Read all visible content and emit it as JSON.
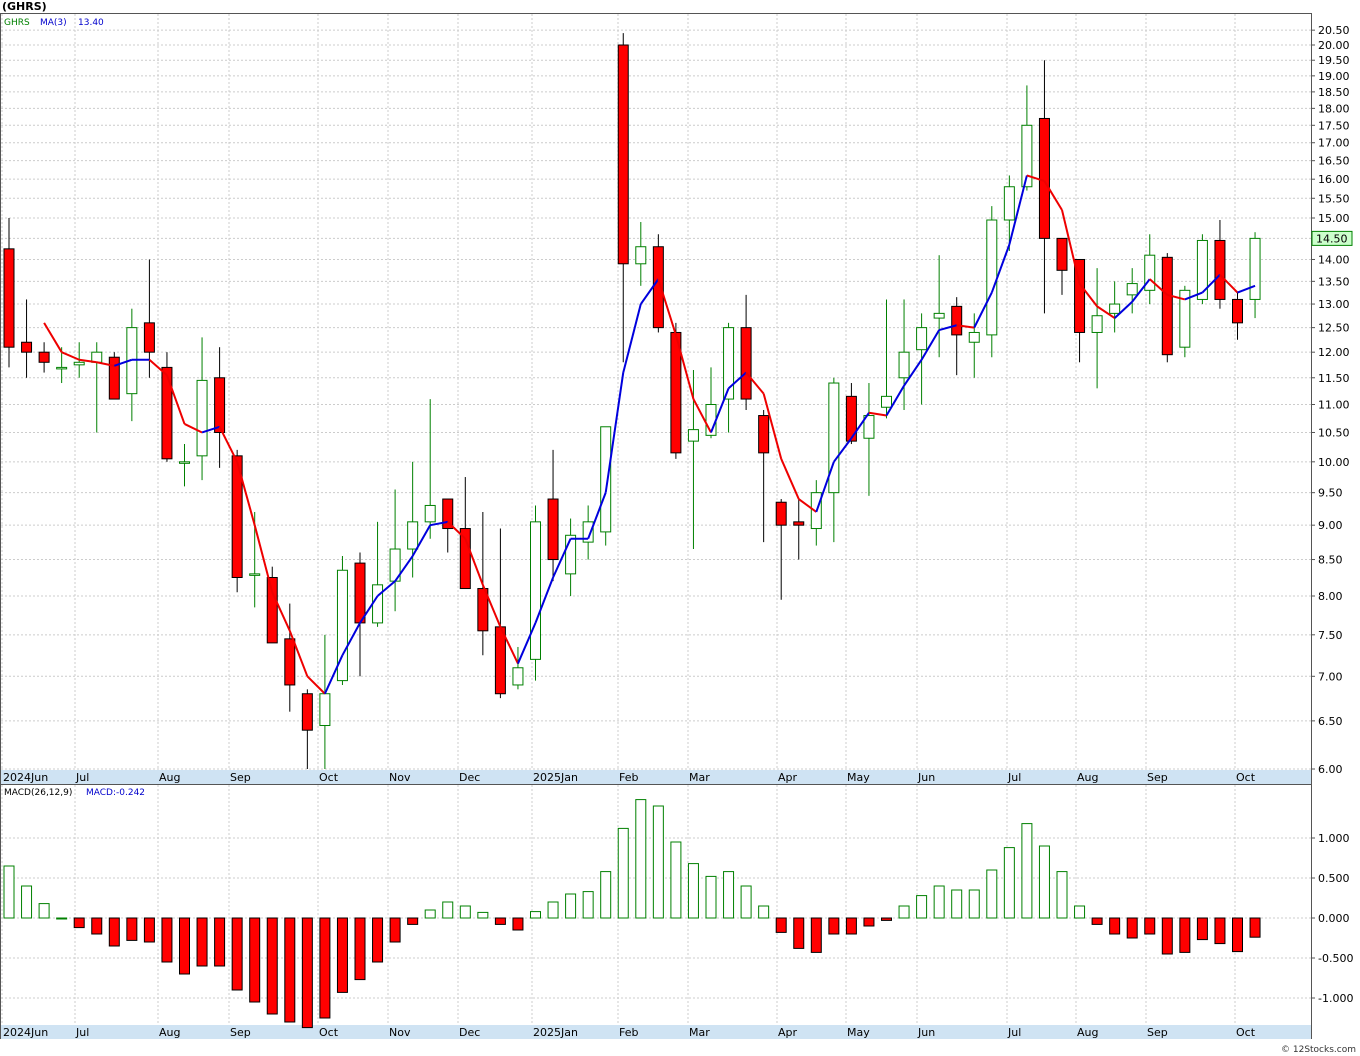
{
  "title": "(GHRS)",
  "footer": "© 12Stocks.com",
  "colors": {
    "up": "#008000",
    "down": "#ff0000",
    "ma_up": "#0000dd",
    "ma_down": "#ee0000",
    "axis_bg": "#cfe3f3",
    "price_tag_bg": "#ccffcc"
  },
  "x_axis_labels": [
    "2024Jun",
    "Jul",
    "Aug",
    "Sep",
    "Oct",
    "Nov",
    "Dec",
    "2025Jan",
    "Feb",
    "Mar",
    "Apr",
    "May",
    "Jun",
    "Jul",
    "Aug",
    "Sep",
    "Oct"
  ],
  "chart_data": [
    {
      "type": "candlestick",
      "title": "(GHRS)",
      "legend": {
        "symbol": "GHRS",
        "indicator": "MA(3)",
        "indicator_value": "13.40"
      },
      "last_price": "14.50",
      "ylim": [
        6.0,
        20.6
      ],
      "y_ticks": [
        "20.50",
        "20.00",
        "19.50",
        "19.00",
        "18.50",
        "18.00",
        "17.50",
        "17.00",
        "16.50",
        "16.00",
        "15.50",
        "15.00",
        "14.50",
        "14.00",
        "13.50",
        "13.00",
        "12.50",
        "12.00",
        "11.50",
        "11.00",
        "10.50",
        "10.00",
        "9.50",
        "9.00",
        "8.50",
        "8.00",
        "7.50",
        "7.00",
        "6.50",
        "6.00"
      ],
      "log_scale": true,
      "grid": true,
      "candles": [
        {
          "o": 14.25,
          "h": 15.0,
          "l": 11.7,
          "c": 12.1
        },
        {
          "o": 12.2,
          "h": 13.1,
          "l": 11.5,
          "c": 12.0
        },
        {
          "o": 12.0,
          "h": 12.2,
          "l": 11.6,
          "c": 11.8
        },
        {
          "o": 11.7,
          "h": 12.1,
          "l": 11.4,
          "c": 11.7
        },
        {
          "o": 11.75,
          "h": 12.2,
          "l": 11.5,
          "c": 11.8
        },
        {
          "o": 11.8,
          "h": 12.2,
          "l": 10.5,
          "c": 12.0
        },
        {
          "o": 11.9,
          "h": 12.0,
          "l": 11.2,
          "c": 11.1
        },
        {
          "o": 11.2,
          "h": 12.9,
          "l": 10.7,
          "c": 12.5
        },
        {
          "o": 12.6,
          "h": 14.0,
          "l": 11.5,
          "c": 12.0
        },
        {
          "o": 11.7,
          "h": 12.0,
          "l": 10.0,
          "c": 10.05
        },
        {
          "o": 10.0,
          "h": 10.3,
          "l": 9.6,
          "c": 10.0
        },
        {
          "o": 10.1,
          "h": 12.3,
          "l": 9.7,
          "c": 11.45
        },
        {
          "o": 11.5,
          "h": 12.1,
          "l": 9.9,
          "c": 10.5
        },
        {
          "o": 10.1,
          "h": 10.2,
          "l": 8.05,
          "c": 8.25
        },
        {
          "o": 8.3,
          "h": 9.2,
          "l": 7.85,
          "c": 8.3
        },
        {
          "o": 8.25,
          "h": 8.4,
          "l": 7.4,
          "c": 7.4
        },
        {
          "o": 7.45,
          "h": 7.9,
          "l": 6.6,
          "c": 6.9
        },
        {
          "o": 6.8,
          "h": 6.85,
          "l": 6.0,
          "c": 6.4
        },
        {
          "o": 6.45,
          "h": 7.5,
          "l": 6.0,
          "c": 6.8
        },
        {
          "o": 6.95,
          "h": 8.55,
          "l": 6.9,
          "c": 8.35
        },
        {
          "o": 8.45,
          "h": 8.6,
          "l": 7.0,
          "c": 7.65
        },
        {
          "o": 7.65,
          "h": 9.05,
          "l": 7.6,
          "c": 8.15
        },
        {
          "o": 8.2,
          "h": 9.55,
          "l": 7.8,
          "c": 8.65
        },
        {
          "o": 8.65,
          "h": 10.0,
          "l": 8.25,
          "c": 9.05
        },
        {
          "o": 9.05,
          "h": 11.1,
          "l": 8.8,
          "c": 9.3
        },
        {
          "o": 9.4,
          "h": 9.4,
          "l": 8.6,
          "c": 8.95
        },
        {
          "o": 8.95,
          "h": 9.75,
          "l": 8.1,
          "c": 8.1
        },
        {
          "o": 8.1,
          "h": 9.2,
          "l": 7.25,
          "c": 7.55
        },
        {
          "o": 7.6,
          "h": 8.95,
          "l": 6.75,
          "c": 6.8
        },
        {
          "o": 6.9,
          "h": 7.35,
          "l": 6.85,
          "c": 7.1
        },
        {
          "o": 7.2,
          "h": 9.3,
          "l": 6.95,
          "c": 9.05
        },
        {
          "o": 9.4,
          "h": 10.2,
          "l": 8.2,
          "c": 8.5
        },
        {
          "o": 8.3,
          "h": 9.1,
          "l": 8.0,
          "c": 8.85
        },
        {
          "o": 8.75,
          "h": 9.3,
          "l": 8.5,
          "c": 9.05
        },
        {
          "o": 8.9,
          "h": 10.6,
          "l": 8.7,
          "c": 10.6
        },
        {
          "o": 20.0,
          "h": 20.4,
          "l": 11.8,
          "c": 13.9
        },
        {
          "o": 13.9,
          "h": 14.9,
          "l": 13.4,
          "c": 14.3
        },
        {
          "o": 14.3,
          "h": 14.6,
          "l": 12.4,
          "c": 12.5
        },
        {
          "o": 12.4,
          "h": 12.6,
          "l": 10.05,
          "c": 10.15
        },
        {
          "o": 10.35,
          "h": 11.65,
          "l": 8.65,
          "c": 10.55
        },
        {
          "o": 10.45,
          "h": 11.7,
          "l": 10.4,
          "c": 11.0
        },
        {
          "o": 11.1,
          "h": 12.6,
          "l": 10.5,
          "c": 12.5
        },
        {
          "o": 12.5,
          "h": 13.2,
          "l": 10.9,
          "c": 11.1
        },
        {
          "o": 10.8,
          "h": 10.9,
          "l": 8.75,
          "c": 10.15
        },
        {
          "o": 9.35,
          "h": 9.4,
          "l": 7.95,
          "c": 9.0
        },
        {
          "o": 9.05,
          "h": 9.4,
          "l": 8.5,
          "c": 9.0
        },
        {
          "o": 8.95,
          "h": 9.7,
          "l": 8.7,
          "c": 9.5
        },
        {
          "o": 9.5,
          "h": 11.5,
          "l": 8.75,
          "c": 11.4
        },
        {
          "o": 11.15,
          "h": 11.4,
          "l": 10.3,
          "c": 10.35
        },
        {
          "o": 10.4,
          "h": 11.4,
          "l": 9.45,
          "c": 10.8
        },
        {
          "o": 10.95,
          "h": 13.1,
          "l": 10.75,
          "c": 11.15
        },
        {
          "o": 11.5,
          "h": 13.1,
          "l": 10.9,
          "c": 12.0
        },
        {
          "o": 12.05,
          "h": 12.8,
          "l": 11.0,
          "c": 12.5
        },
        {
          "o": 12.7,
          "h": 14.1,
          "l": 11.9,
          "c": 12.8
        },
        {
          "o": 12.95,
          "h": 13.15,
          "l": 11.55,
          "c": 12.35
        },
        {
          "o": 12.2,
          "h": 12.8,
          "l": 11.5,
          "c": 12.4
        },
        {
          "o": 12.35,
          "h": 15.3,
          "l": 11.9,
          "c": 14.95
        },
        {
          "o": 14.95,
          "h": 16.1,
          "l": 14.2,
          "c": 15.8
        },
        {
          "o": 15.8,
          "h": 18.7,
          "l": 15.7,
          "c": 17.5
        },
        {
          "o": 17.7,
          "h": 19.5,
          "l": 12.8,
          "c": 14.5
        },
        {
          "o": 14.5,
          "h": 14.5,
          "l": 13.2,
          "c": 13.75
        },
        {
          "o": 14.0,
          "h": 14.0,
          "l": 11.8,
          "c": 12.4
        },
        {
          "o": 12.4,
          "h": 13.8,
          "l": 11.3,
          "c": 12.75
        },
        {
          "o": 12.8,
          "h": 13.5,
          "l": 12.4,
          "c": 13.0
        },
        {
          "o": 13.2,
          "h": 13.8,
          "l": 12.8,
          "c": 13.45
        },
        {
          "o": 13.3,
          "h": 14.6,
          "l": 13.0,
          "c": 14.1
        },
        {
          "o": 14.05,
          "h": 14.15,
          "l": 11.8,
          "c": 11.95
        },
        {
          "o": 12.1,
          "h": 13.4,
          "l": 11.9,
          "c": 13.3
        },
        {
          "o": 13.1,
          "h": 14.6,
          "l": 13.0,
          "c": 14.45
        },
        {
          "o": 14.45,
          "h": 14.95,
          "l": 12.9,
          "c": 13.1
        },
        {
          "o": 13.1,
          "h": 13.25,
          "l": 12.25,
          "c": 12.6
        },
        {
          "o": 13.1,
          "h": 14.65,
          "l": 12.7,
          "c": 14.5
        }
      ],
      "ma": [
        null,
        null,
        12.6,
        12.0,
        11.85,
        11.8,
        11.73,
        11.85,
        11.85,
        11.55,
        10.65,
        10.5,
        10.6,
        10.0,
        9.0,
        8.05,
        7.55,
        7.0,
        6.8,
        7.25,
        7.65,
        8.0,
        8.2,
        8.55,
        9.0,
        9.05,
        8.8,
        8.15,
        7.6,
        7.15,
        7.65,
        8.25,
        8.8,
        8.8,
        9.5,
        11.6,
        13.0,
        13.55,
        12.35,
        11.1,
        10.5,
        11.3,
        11.6,
        11.2,
        10.05,
        9.4,
        9.2,
        10.0,
        10.4,
        10.85,
        10.8,
        11.35,
        11.85,
        12.45,
        12.55,
        12.5,
        13.25,
        14.35,
        16.1,
        15.95,
        15.2,
        13.45,
        12.95,
        12.7,
        13.05,
        13.55,
        13.2,
        13.1,
        13.25,
        13.65,
        13.25,
        13.4
      ]
    },
    {
      "type": "bar",
      "title": "MACD(26,12,9)",
      "legend": {
        "name": "MACD(26,12,9)",
        "value_label": "MACD:-0.242"
      },
      "ylim": [
        -1.4,
        1.55
      ],
      "y_ticks": [
        "1.000",
        "0.500",
        "0.000",
        "-0.500",
        "-1.000"
      ],
      "values": [
        0.65,
        0.4,
        0.18,
        0.0,
        -0.12,
        -0.2,
        -0.35,
        -0.28,
        -0.3,
        -0.55,
        -0.7,
        -0.6,
        -0.6,
        -0.9,
        -1.05,
        -1.2,
        -1.3,
        -1.37,
        -1.25,
        -0.93,
        -0.77,
        -0.55,
        -0.3,
        -0.08,
        0.1,
        0.2,
        0.15,
        0.07,
        -0.08,
        -0.15,
        0.08,
        0.2,
        0.3,
        0.33,
        0.58,
        1.12,
        1.48,
        1.4,
        0.95,
        0.68,
        0.52,
        0.58,
        0.4,
        0.15,
        -0.18,
        -0.38,
        -0.43,
        -0.2,
        -0.2,
        -0.1,
        -0.03,
        0.15,
        0.28,
        0.4,
        0.35,
        0.35,
        0.6,
        0.88,
        1.18,
        0.9,
        0.58,
        0.15,
        -0.08,
        -0.2,
        -0.25,
        -0.2,
        -0.45,
        -0.43,
        -0.27,
        -0.32,
        -0.42,
        -0.24
      ]
    }
  ]
}
